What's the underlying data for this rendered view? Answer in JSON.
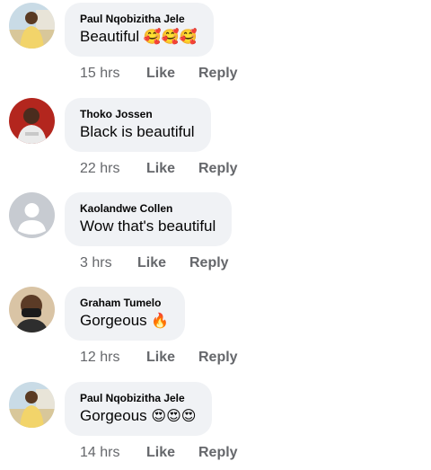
{
  "comments": [
    {
      "author": "Paul Nqobizitha Jele",
      "text": "Beautiful",
      "emoji": "🥰🥰🥰",
      "time": "15 hrs",
      "avatar_icon": "person-outdoor-photo-icon"
    },
    {
      "author": "Thoko Jossen",
      "text": "Black is beautiful",
      "emoji": "",
      "time": "22 hrs",
      "avatar_icon": "person-red-background-photo-icon"
    },
    {
      "author": "Kaolandwe Collen",
      "text": "Wow that's beautiful",
      "emoji": "",
      "time": "3 hrs",
      "avatar_icon": "default-avatar-icon"
    },
    {
      "author": "Graham Tumelo",
      "text": "Gorgeous",
      "emoji": "🔥",
      "time": "12 hrs",
      "avatar_icon": "person-with-mask-photo-icon"
    },
    {
      "author": "Paul Nqobizitha Jele",
      "text": "Gorgeous",
      "emoji": "😍😍😍",
      "time": "14 hrs",
      "avatar_icon": "person-outdoor-photo-icon"
    }
  ],
  "actions": {
    "like_label": "Like",
    "reply_label": "Reply"
  },
  "colors": {
    "bubble_bg": "#f0f2f5",
    "meta_text": "#65676b",
    "primary_text": "#050505"
  }
}
